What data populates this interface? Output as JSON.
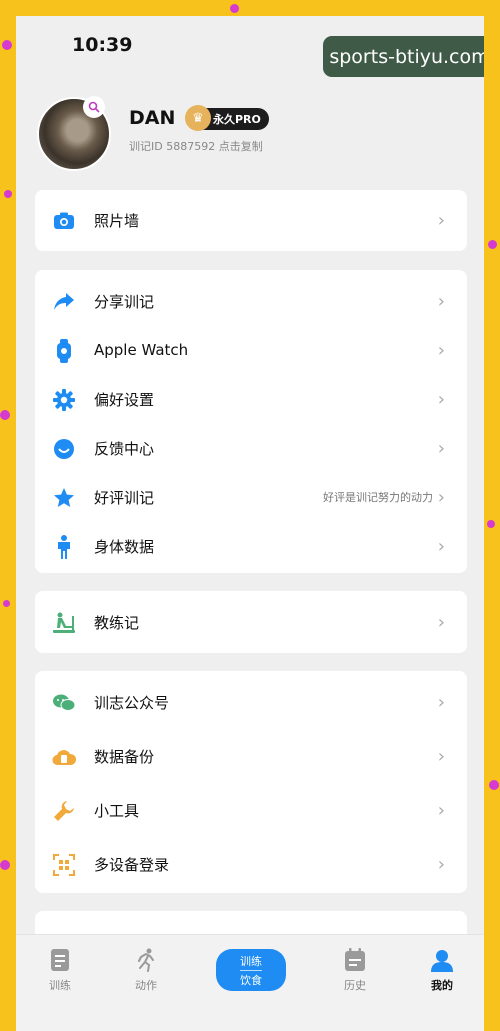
{
  "status": {
    "time": "10:39"
  },
  "watermark": "sports-btiyu.com",
  "profile": {
    "name": "DAN",
    "badge": "永久PRO",
    "id_line": "训记ID 5887592 点击复制"
  },
  "menu_group1": [
    {
      "label": "照片墙",
      "icon": "camera-icon"
    }
  ],
  "menu_group2": [
    {
      "label": "分享训记",
      "icon": "share-icon"
    },
    {
      "label": "Apple Watch",
      "icon": "watch-icon"
    },
    {
      "label": "偏好设置",
      "icon": "gear-icon"
    },
    {
      "label": "反馈中心",
      "icon": "smile-icon"
    },
    {
      "label": "好评训记",
      "icon": "star-icon",
      "hint": "好评是训记努力的动力"
    },
    {
      "label": "身体数据",
      "icon": "person-icon"
    }
  ],
  "menu_group3": [
    {
      "label": "教练记",
      "icon": "coach-icon"
    }
  ],
  "menu_group4": [
    {
      "label": "训志公众号",
      "icon": "wechat-icon"
    },
    {
      "label": "数据备份",
      "icon": "cloud-backup-icon"
    },
    {
      "label": "小工具",
      "icon": "wrench-icon"
    },
    {
      "label": "多设备登录",
      "icon": "qr-code-icon"
    }
  ],
  "tabbar": {
    "train": "训练",
    "moves": "动作",
    "center_top": "训练",
    "center_bottom": "饮食",
    "history": "历史",
    "mine": "我的"
  },
  "colors": {
    "accent": "#1e8cf2",
    "background": "#f7c21b",
    "green": "#4caf7a",
    "orange": "#f2a93b"
  }
}
